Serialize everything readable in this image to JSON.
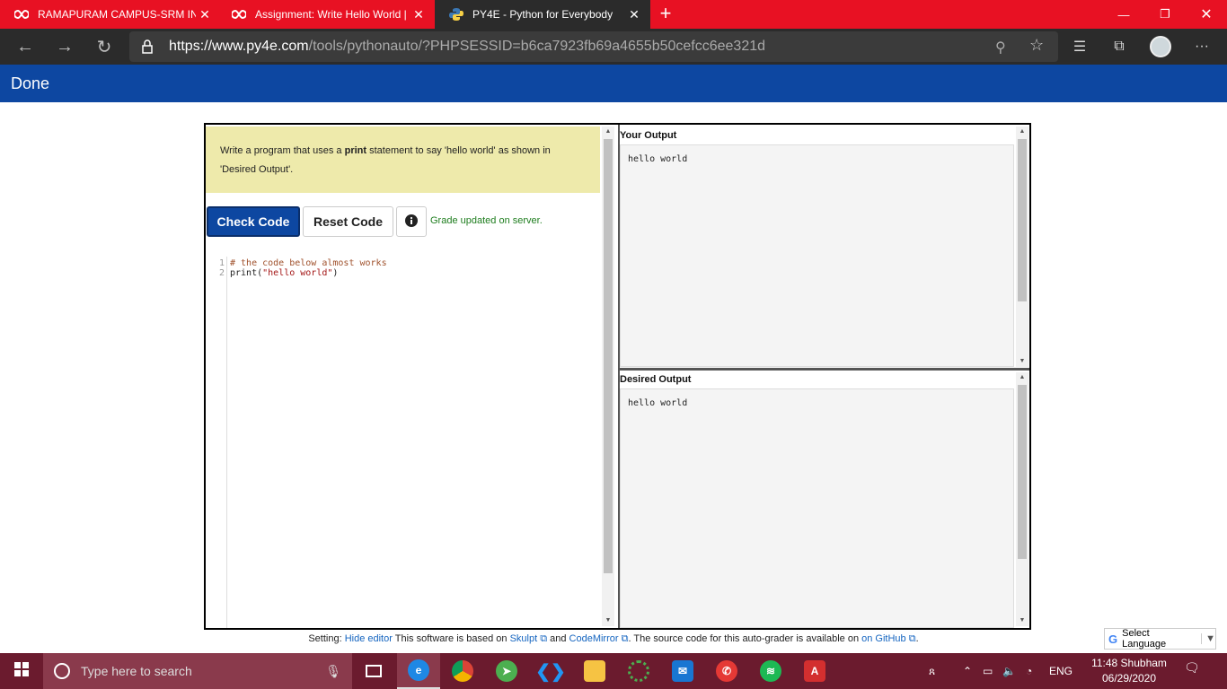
{
  "browser": {
    "tabs": [
      {
        "title": "RAMAPURAM CAMPUS-SRM INS",
        "active": false
      },
      {
        "title": "Assignment: Write Hello World |",
        "active": false
      },
      {
        "title": "PY4E - Python for Everybody",
        "active": true
      }
    ],
    "url_host": "https://www.py4e.com",
    "url_path": "/tools/pythonauto/?PHPSESSID=b6ca7923fb69a4655b50cefcc6ee321d",
    "colors": {
      "tabbar": "#e81123",
      "chrome": "#2b2b2b"
    }
  },
  "header": {
    "title": "Done",
    "color": "#0d47a1"
  },
  "instructions": {
    "pre": "Write a program that uses a ",
    "bold": "print",
    "post": " statement to say 'hello world' as shown in 'Desired Output'."
  },
  "buttons": {
    "check": "Check Code",
    "reset": "Reset Code"
  },
  "status": "Grade updated on server.",
  "editor": {
    "line_numbers": [
      "1",
      "2"
    ],
    "line1": "# the code below almost works",
    "line2_fn": "print(",
    "line2_str": "\"hello world\"",
    "line2_end": ")"
  },
  "output": {
    "your_title": "Your Output",
    "your_text": "hello world",
    "desired_title": "Desired Output",
    "desired_text": "hello world"
  },
  "footer": {
    "t1": "Setting: ",
    "hide_editor": "Hide editor",
    "t2": " This software is based on ",
    "skulpt": "Skulpt",
    "t3": " and ",
    "codemirror": "CodeMirror",
    "t4": ". The source code for this auto-grader is available on ",
    "github": "on GitHub",
    "t5": "."
  },
  "language_selector": "Select Language",
  "taskbar": {
    "search_placeholder": "Type here to search",
    "lang": "ENG",
    "time": "11:48 Shubham",
    "date": "06/29/2020"
  }
}
